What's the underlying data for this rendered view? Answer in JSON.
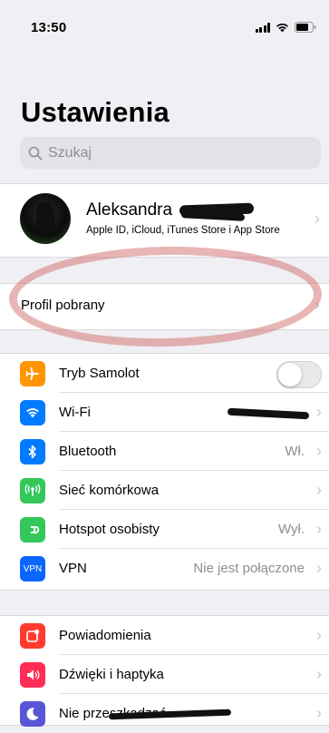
{
  "status_bar": {
    "time": "13:50"
  },
  "page": {
    "title": "Ustawienia"
  },
  "search": {
    "placeholder": "Szukaj"
  },
  "profile": {
    "name": "Aleksandra",
    "subtitle": "Apple ID, iCloud, iTunes Store i App Store"
  },
  "downloaded_profile": {
    "label": "Profil pobrany"
  },
  "connectivity": [
    {
      "label": "Tryb Samolot",
      "icon": "airplane-icon",
      "color": "#ff9500",
      "toggle": false
    },
    {
      "label": "Wi-Fi",
      "icon": "wifi-icon",
      "color": "#007aff",
      "value": ""
    },
    {
      "label": "Bluetooth",
      "icon": "bluetooth-icon",
      "color": "#007aff",
      "value": "Wł."
    },
    {
      "label": "Sieć komórkowa",
      "icon": "cellular-icon",
      "color": "#34c759",
      "value": ""
    },
    {
      "label": "Hotspot osobisty",
      "icon": "hotspot-icon",
      "color": "#34c759",
      "value": "Wył."
    },
    {
      "label": "VPN",
      "icon": "vpn-icon",
      "color": "#0a66ff",
      "value": "Nie jest połączone"
    }
  ],
  "notifications": [
    {
      "label": "Powiadomienia",
      "icon": "notifications-icon",
      "color": "#ff3b30"
    },
    {
      "label": "Dźwięki i haptyka",
      "icon": "sounds-icon",
      "color": "#ff2d55"
    },
    {
      "label": "Nie przeszkadzać",
      "icon": "moon-icon",
      "color": "#5856d6"
    }
  ],
  "icon_glyphs": {
    "vpn": "VPN"
  }
}
